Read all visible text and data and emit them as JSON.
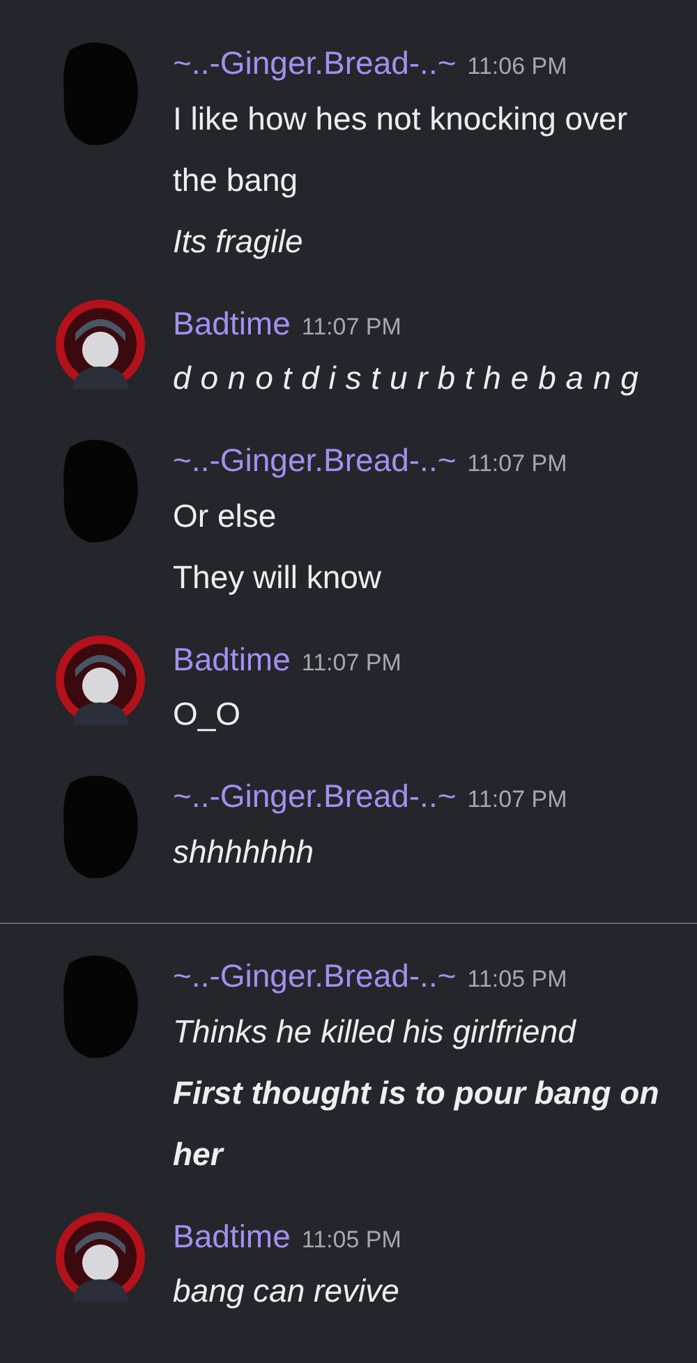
{
  "sections": [
    {
      "messages": [
        {
          "author": "~..-Ginger.Bread-..~",
          "time": "11:06 PM",
          "kind": "redacted",
          "lines": [
            {
              "text": "I like how hes not knocking over the bang",
              "kind": "plain"
            },
            {
              "text": "Its fragile",
              "kind": "italic"
            }
          ]
        },
        {
          "author": "Badtime",
          "time": "11:07 PM",
          "kind": "avatar",
          "lines": [
            {
              "text": "donotdisturbthebang",
              "kind": "spaced"
            }
          ]
        },
        {
          "author": "~..-Ginger.Bread-..~",
          "time": "11:07 PM",
          "kind": "redacted",
          "lines": [
            {
              "text": "Or else",
              "kind": "plain"
            },
            {
              "text": "They will know",
              "kind": "plain"
            }
          ]
        },
        {
          "author": "Badtime",
          "time": "11:07 PM",
          "kind": "avatar",
          "lines": [
            {
              "text": "O_O",
              "kind": "plain"
            }
          ]
        },
        {
          "author": "~..-Ginger.Bread-..~",
          "time": "11:07 PM",
          "kind": "redacted",
          "lines": [
            {
              "text": "shhhhhhh",
              "kind": "italic"
            }
          ]
        }
      ]
    },
    {
      "messages": [
        {
          "author": "~..-Ginger.Bread-..~",
          "time": "11:05 PM",
          "kind": "redacted",
          "lines": [
            {
              "text": "Thinks he killed his girlfriend",
              "kind": "italic"
            },
            {
              "text": "First thought is to pour bang on her",
              "kind": "bold"
            }
          ]
        },
        {
          "author": "Badtime",
          "time": "11:05 PM",
          "kind": "avatar",
          "lines": [
            {
              "text": "bang can revive",
              "kind": "italic"
            }
          ]
        }
      ]
    }
  ]
}
